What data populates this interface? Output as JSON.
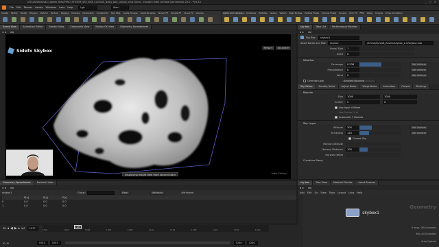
{
  "titlebar": {
    "title": "/ATLAS/Work/sdx-cl/work_files/PYRO_SYSTEM_SKY_BOX_CLOUDS_N/sky_box_clouds_v001.hipnc - Houdini Indie Limited-Commercial 20.0 - Py3.10"
  },
  "menubar": {
    "items": [
      "File",
      "Edit",
      "Render",
      "Assets",
      "Windows",
      "Labs",
      "Help"
    ],
    "desktop": "Lgh",
    "main": "Main"
  },
  "shelf_tabs_left": [
    "Create",
    "Modify",
    "Model",
    "Polygon",
    "Deform",
    "Texture",
    "Rigging",
    "Muscles",
    "Characters",
    "Constraints",
    "Hair Utils",
    "Guide Process",
    "Guide Brushes",
    "Terrain FX",
    "Simple FX",
    "Cloud FX",
    "Volume"
  ],
  "shelf_tabs_right": [
    "Lights and Cameras",
    "Collisions",
    "Particles",
    "Grains",
    "Vellum",
    "Rigid Bodies",
    "Particle Fluids",
    "Viscous Fluids",
    "Oceans",
    "Pyro FX",
    "FEM",
    "Wires",
    "Crowds",
    "Drive Simulation"
  ],
  "pane_tabs_top": [
    "Scene View",
    "Animation Editor",
    "Render View",
    "Composite View",
    "Motion FX View",
    "Geometry Spreadsheet"
  ],
  "viewport": {
    "path": "obj",
    "node_label": "Sidefx Skybox",
    "persp_label": "Persp ▾",
    "cam_label": "No cam ▾",
    "tooltip": "Displaying height field from second stack",
    "corner": "Indie Edition"
  },
  "param_panel": {
    "tabs": [
      "sky box",
      "Take List",
      "Performance Monitor"
    ],
    "path": "obj",
    "node_type": "Sky Box",
    "node_name": "skybox1",
    "asset_name_label": "Asset Name and Path",
    "asset_name_value": "Skybox",
    "asset_path_value": "/ATLAS/lib/LAB_Assets/skybox_2.0/skybox.hda",
    "visual_size_label": "Visual Size",
    "visual_size_value": "1",
    "seed_label": "Seed",
    "seed_value": "0",
    "weather_section": "Weather",
    "coverage_label": "Coverage",
    "coverage_value": "0.534",
    "precip_label": "Precipitation",
    "precip_value": "0",
    "wind_label": "Wind",
    "wind_value": "0",
    "set_uniform": "Set Uniform",
    "override_label": "Override Look",
    "override_value": "Ambient Bounced",
    "subtabs": [
      "Sky Setup",
      "Density Noise",
      "Adjust Noise",
      "Wisps Noise",
      "Animation",
      "Output",
      "Bindings"
    ],
    "bounds_section": "Bounds",
    "size_label": "Size",
    "size_x": "1000",
    "size_y": "1000",
    "center_label": "Center",
    "center_x": "0",
    "center_y": "0",
    "use_input_label": "Use Input if Wired",
    "use_center_label": "Use Center Grid",
    "auto_y_label": "Automatic Y Bounds",
    "sky_layer_section": "Sky Layer",
    "altitude_label": "Altitude",
    "altitude_value": "300",
    "thickness_label": "Thickness",
    "thickness_value": "120",
    "correct_label": "Correct Sky",
    "horizon_alt_label": "Horizon Altitude",
    "horizon_dist_label": "Horizon Distance",
    "horizon_dist_value": "100",
    "horizon_offset_label": "Horizon Offset",
    "curvature_label": "Curvature Ramp"
  },
  "spreadsheet": {
    "tabs": [
      "Geometry Spreadsheet",
      "Network View"
    ],
    "path": "obj",
    "node": "skybox1",
    "group_label": "Group:",
    "view_label": "View",
    "intrinsics_label": "Intrinsics",
    "attributes_label": "Attributes:",
    "columns": [
      "",
      "P[x]",
      "P[y]",
      "P[z]"
    ],
    "rows": [
      [
        "0",
        "0.0",
        "0.0",
        "0.0"
      ],
      [
        "1",
        "0.0",
        "0.0",
        "0.0"
      ]
    ]
  },
  "network": {
    "tabs": [
      "sky box",
      "Tree View",
      "Material Palette",
      "Asset Browser"
    ],
    "path": "obj",
    "menu": [
      "Add",
      "Edit",
      "Go",
      "View",
      "Tools",
      "Layout",
      "Labs",
      "Help"
    ],
    "node_name": "skybox1",
    "context_label": "Geometry"
  },
  "timeline": {
    "frame": "1037",
    "start": "1001",
    "start2": "1001",
    "end": "1240",
    "end2": "1240",
    "ticks": [
      "1001",
      "1024",
      "1048",
      "1072",
      "1096",
      "1120",
      "1144",
      "1168",
      "1192",
      "1216",
      "1240"
    ],
    "current_marker": "1037",
    "keys_label": "0 keys, 0/0 channels",
    "key_all": "Key All Channels",
    "auto_update": "Auto Update"
  }
}
